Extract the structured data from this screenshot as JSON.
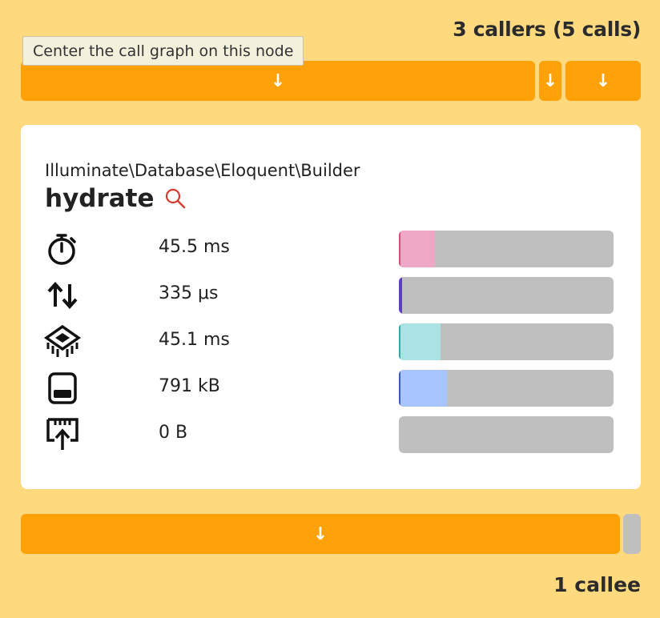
{
  "header": {
    "callers_label": "3 callers (5 calls)"
  },
  "tooltip": {
    "text": "Center the call graph on this node"
  },
  "callers": [
    {
      "arrow": "↓"
    },
    {
      "arrow": "↓"
    },
    {
      "arrow": "↓"
    }
  ],
  "node": {
    "namespace": "Illuminate\\Database\\Eloquent\\Builder",
    "function": "hydrate",
    "metrics": [
      {
        "icon": "stopwatch-icon",
        "value": "45.5 ms",
        "fill_fraction": 0.16,
        "color": "#eea7c4",
        "edge": "#d84b7d"
      },
      {
        "icon": "io-arrows-icon",
        "value": "335 μs",
        "fill_fraction": 0.008,
        "color": "#5a3fc0",
        "edge": "#5a3fc0"
      },
      {
        "icon": "cpu-icon",
        "value": "45.1 ms",
        "fill_fraction": 0.185,
        "color": "#a9e3e3",
        "edge": "#33aaaa"
      },
      {
        "icon": "memory-icon",
        "value": "791 kB",
        "fill_fraction": 0.215,
        "color": "#a8c5ff",
        "edge": "#3a5ab8"
      },
      {
        "icon": "network-icon",
        "value": "0 B",
        "fill_fraction": 0,
        "color": "#c0bfc0",
        "edge": "#c0bfc0"
      }
    ]
  },
  "callee": {
    "arrow": "↓"
  },
  "footer": {
    "callees_label": "1 callee"
  },
  "colors": {
    "background": "#ffd97e",
    "accent": "#ffa20a",
    "search": "#d63b2f"
  }
}
